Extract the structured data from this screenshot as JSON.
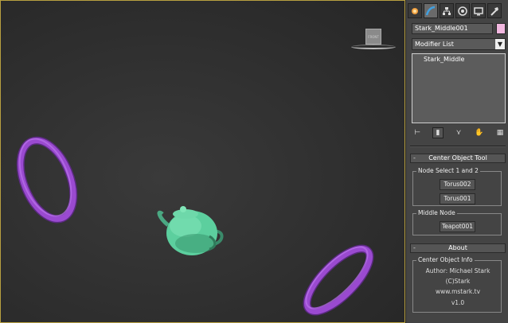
{
  "viewport": {
    "viewcube_label": "FRONT"
  },
  "command_panel": {
    "tabs": [
      {
        "icon": "create-icon",
        "color": "#f0a040"
      },
      {
        "icon": "modify-icon",
        "color": "#40a0e0"
      },
      {
        "icon": "hierarchy-icon",
        "color": "#dddddd"
      },
      {
        "icon": "motion-icon",
        "color": "#dddddd"
      },
      {
        "icon": "display-icon",
        "color": "#dddddd"
      },
      {
        "icon": "utilities-icon",
        "color": "#dddddd"
      }
    ],
    "object_name": "Stark_Middle001",
    "object_color": "#f2b8e0",
    "modifier_list": "Modifier List",
    "modifier_stack": [
      "Stark_Middle"
    ]
  },
  "center_object_tool": {
    "title": "Center Object Tool",
    "node_group_label": "Node Select 1 and 2",
    "node1_button": "Torus002",
    "node2_button": "Torus001",
    "middle_group_label": "Middle Node",
    "middle_button": "Teapot001"
  },
  "about": {
    "title": "About",
    "group_label": "Center Object Info",
    "author": "Author: Michael Stark",
    "copyright": "(C)Stark",
    "website": "www.mstark.tv",
    "version": "v1.0"
  },
  "rollout_collapse_symbol": "-"
}
